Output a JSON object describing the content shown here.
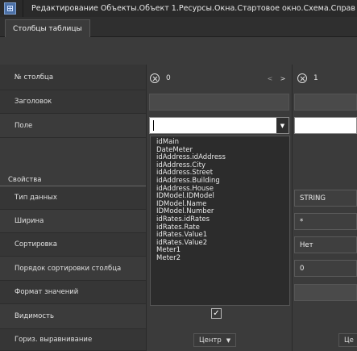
{
  "window": {
    "title": "Редактирование Объекты.Объект 1.Ресурсы.Окна.Стартовое окно.Схема.Справ",
    "app_icon": "table-grid-icon"
  },
  "tabs": [
    {
      "label": "Столбцы таблицы",
      "active": true
    }
  ],
  "rows": {
    "column_number": {
      "label": "№ столбца",
      "col1_value": "0",
      "col2_value": "1",
      "prev_icon": "<",
      "next_icon": ">"
    },
    "header": {
      "label": "Заголовок",
      "col1_value": "",
      "col2_value": ""
    },
    "field": {
      "label": "Поле",
      "col1_value": "",
      "dropdown_icon": "▼"
    },
    "properties": {
      "label": "Свойства"
    },
    "data_type": {
      "label": "Тип данных",
      "col2_value": "STRING"
    },
    "width": {
      "label": "Ширина",
      "col2_value": "*"
    },
    "sort": {
      "label": "Сортировка",
      "col2_value": "Нет"
    },
    "sort_order": {
      "label": "Порядок сортировки столбца",
      "col2_value": "0"
    },
    "value_format": {
      "label": "Формат значений",
      "col2_value": ""
    },
    "visibility": {
      "label": "Видимость",
      "checked": true,
      "check_glyph": "✓"
    },
    "h_align": {
      "label": "Гориз. выравнивание",
      "col1_value": "Центр",
      "col1_arrow": "▼",
      "col2_value": "Це"
    }
  },
  "field_dropdown_options": [
    "idMain",
    "DateMeter",
    "idAddress.idAddress",
    "idAddress.City",
    "idAddress.Street",
    "idAddress.Building",
    "idAddress.House",
    "IDModel.IDModel",
    "IDModel.Name",
    "IDModel.Number",
    "idRates.idRates",
    "idRates.Rate",
    "idRates.Value1",
    "idRates.Value2",
    "Meter1",
    "Meter2"
  ]
}
